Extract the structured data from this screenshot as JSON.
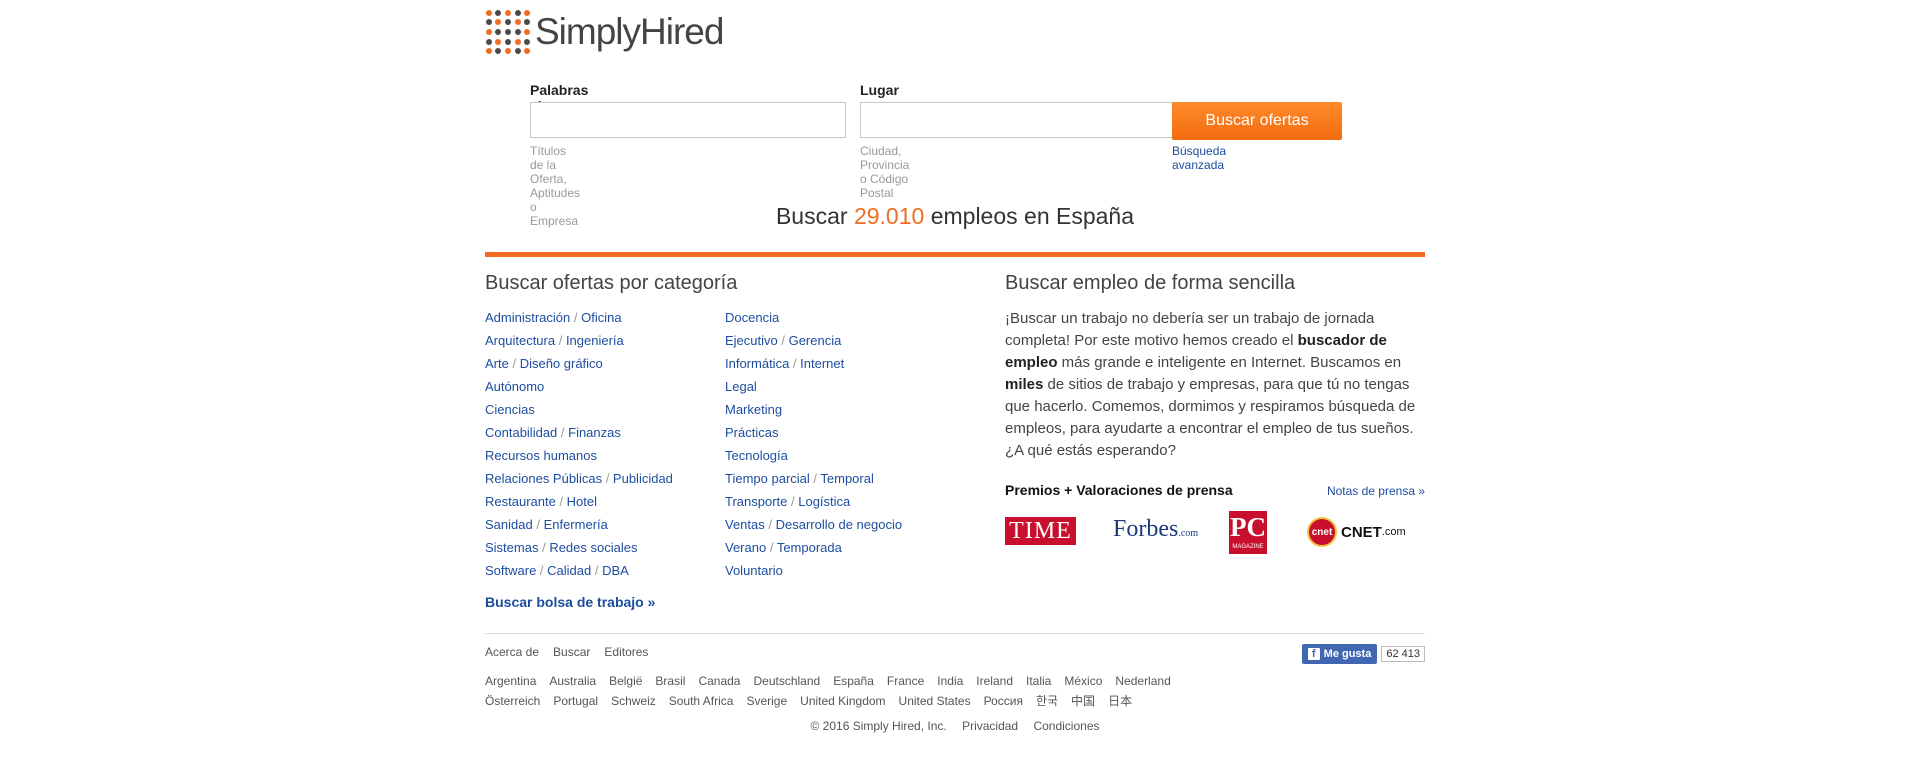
{
  "brand": {
    "name": "SimplyHired"
  },
  "search": {
    "keywords_label": "Palabras clave",
    "keywords_placeholder": "",
    "keywords_hint": "Títulos de la Oferta, Aptitudes o Empresa",
    "location_label": "Lugar",
    "location_placeholder": "",
    "location_hint": "Ciudad, Provincia o Código Postal",
    "button_label": "Buscar ofertas",
    "advanced_link": "Búsqueda avanzada"
  },
  "headline": {
    "prefix": "Buscar ",
    "count": "29.010",
    "suffix": " empleos en España"
  },
  "categories": {
    "title": "Buscar ofertas por categoría",
    "col1": [
      [
        "Administración",
        "Oficina"
      ],
      [
        "Arquitectura",
        "Ingeniería"
      ],
      [
        "Arte",
        "Diseño gráfico"
      ],
      [
        "Autónomo"
      ],
      [
        "Ciencias"
      ],
      [
        "Contabilidad",
        "Finanzas"
      ],
      [
        "Recursos humanos"
      ],
      [
        "Relaciones Públicas",
        "Publicidad"
      ],
      [
        "Restaurante",
        "Hotel"
      ],
      [
        "Sanidad",
        "Enfermería"
      ],
      [
        "Sistemas",
        "Redes sociales"
      ],
      [
        "Software",
        "Calidad",
        "DBA"
      ]
    ],
    "col2": [
      [
        "Docencia"
      ],
      [
        "Ejecutivo",
        "Gerencia"
      ],
      [
        "Informática",
        "Internet"
      ],
      [
        "Legal"
      ],
      [
        "Marketing"
      ],
      [
        "Prácticas"
      ],
      [
        "Tecnología"
      ],
      [
        "Tiempo parcial",
        "Temporal"
      ],
      [
        "Transporte",
        "Logística"
      ],
      [
        "Ventas",
        "Desarrollo de negocio"
      ],
      [
        "Verano",
        "Temporada"
      ],
      [
        "Voluntario"
      ]
    ],
    "browse_link": "Buscar bolsa de trabajo »"
  },
  "about": {
    "title": "Buscar empleo de forma sencilla",
    "p1": "¡Buscar un trabajo no debería ser un trabajo de jornada completa! Por este motivo hemos creado el ",
    "b1": "buscador de empleo",
    "p2": " más grande e inteligente en Internet. Buscamos en ",
    "b2": "miles",
    "p3": " de sitios de trabajo y empresas, para que tú no tengas que hacerlo. Comemos, dormimos y respiramos búsqueda de empleos, para ayudarte a encontrar el empleo de tus sueños. ¿A qué estás esperando?"
  },
  "press": {
    "title": "Premios + Valoraciones de prensa",
    "link": "Notas de prensa »",
    "logos": {
      "time": "TIME",
      "forbes": "Forbes",
      "forbes_sub": ".com",
      "pc": "PC",
      "pc_sub": "MAGAZINE",
      "cnet_badge": "cnet",
      "cnet": "CNET",
      "cnet_sub": ".com"
    }
  },
  "footer": {
    "links": [
      "Acerca de",
      "Buscar",
      "Editores"
    ],
    "countries_row1": [
      "Argentina",
      "Australia",
      "België",
      "Brasil",
      "Canada",
      "Deutschland",
      "España",
      "France",
      "India",
      "Ireland",
      "Italia",
      "México",
      "Nederland"
    ],
    "countries_row2": [
      "Österreich",
      "Portugal",
      "Schweiz",
      "South Africa",
      "Sverige",
      "United Kingdom",
      "United States",
      "Россия",
      "한국",
      "中国",
      "日本"
    ],
    "copyright": "© 2016 Simply Hired, Inc.",
    "privacy": "Privacidad",
    "terms": "Condiciones",
    "fb_like": "Me gusta",
    "fb_count": "62 413"
  },
  "colors": {
    "accent": "#f26c21",
    "link": "#1d4d9f"
  }
}
